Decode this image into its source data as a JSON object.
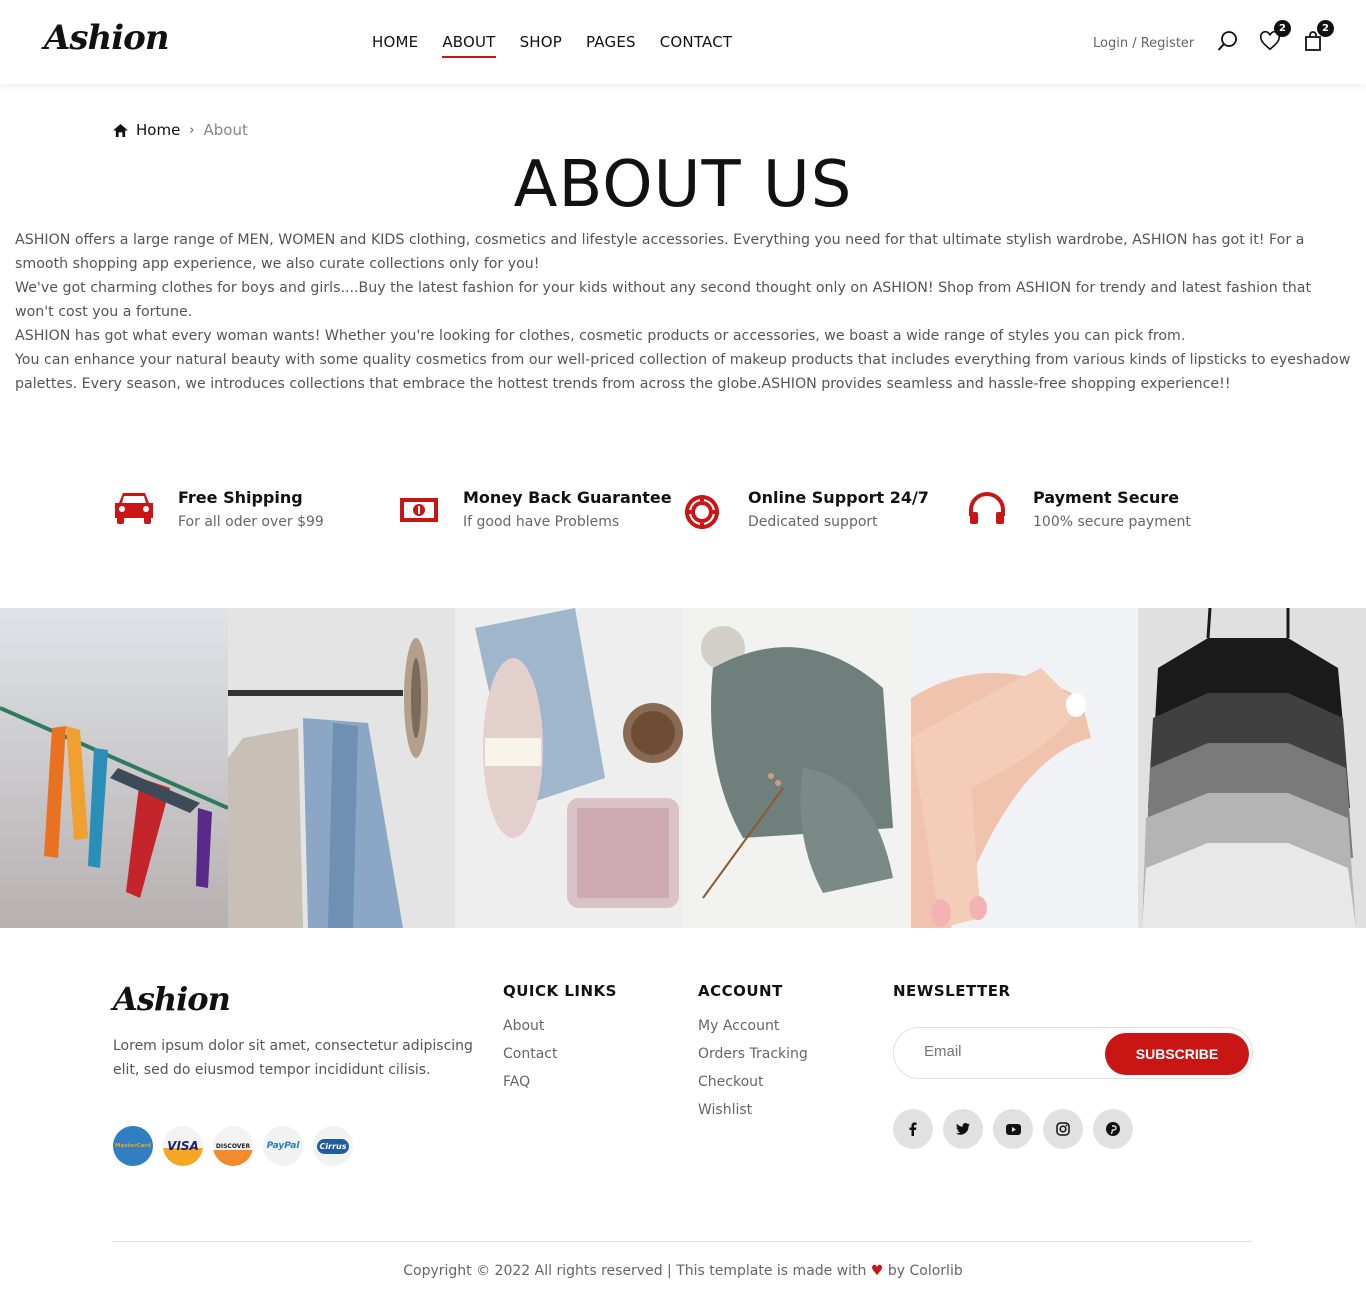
{
  "brand": "Ashion",
  "nav": {
    "home": "HOME",
    "about": "ABOUT",
    "shop": "SHOP",
    "pages": "PAGES",
    "contact": "CONTACT"
  },
  "auth": {
    "login": "Login",
    "separator": " / ",
    "register": "Register"
  },
  "badges": {
    "wishlist": "2",
    "cart": "2"
  },
  "breadcrumb": {
    "home": "Home",
    "current": "About"
  },
  "page_title": "ABOUT US",
  "about_paragraphs": [
    "ASHION offers a large range of MEN, WOMEN and KIDS clothing, cosmetics and lifestyle accessories. Everything you need for that ultimate stylish wardrobe, ASHION has got it! For a smooth shopping app experience, we also curate collections only for you!",
    "We've got charming clothes for boys and girls....Buy the latest fashion for your kids without any second thought only on ASHION! Shop from ASHION for trendy and latest fashion that won't cost you a fortune.",
    "ASHION has got what every woman wants! Whether you're looking for clothes, cosmetic products or accessories, we boast a wide range of styles you can pick from.",
    "You can enhance your natural beauty with some quality cosmetics from our well-priced collection of makeup products that includes everything from various kinds of lipsticks to eyeshadow palettes. Every season, we introduces collections that embrace the hottest trends from across the globe.ASHION provides seamless and hassle-free shopping experience!!"
  ],
  "features": [
    {
      "title": "Free Shipping",
      "text": "For all oder over $99",
      "icon": "car-icon"
    },
    {
      "title": "Money Back Guarantee",
      "text": "If good have Problems",
      "icon": "money-icon"
    },
    {
      "title": "Online Support 24/7",
      "text": "Dedicated support",
      "icon": "life-ring-icon"
    },
    {
      "title": "Payment Secure",
      "text": "100% secure payment",
      "icon": "headphones-icon"
    }
  ],
  "footer": {
    "brand": "Ashion",
    "text": "Lorem ipsum dolor sit amet, consectetur adipiscing elit, sed do eiusmod tempor incididunt cilisis.",
    "cards": [
      "MasterCard",
      "VISA",
      "DISCOVER",
      "PayPal",
      "Cirrus"
    ],
    "quick_links": {
      "title": "QUICK LINKS",
      "items": [
        "About",
        "Contact",
        "FAQ"
      ]
    },
    "account": {
      "title": "ACCOUNT",
      "items": [
        "My Account",
        "Orders Tracking",
        "Checkout",
        "Wishlist"
      ]
    },
    "newsletter": {
      "title": "NEWSLETTER",
      "placeholder": "Email",
      "button": "SUBSCRIBE"
    },
    "copyright_pre": "Copyright © 2022 All rights reserved | This template is made with ",
    "copyright_post": " by Colorlib"
  },
  "colors": {
    "accent": "#ca1515",
    "text": "#111111",
    "muted": "#666666"
  }
}
